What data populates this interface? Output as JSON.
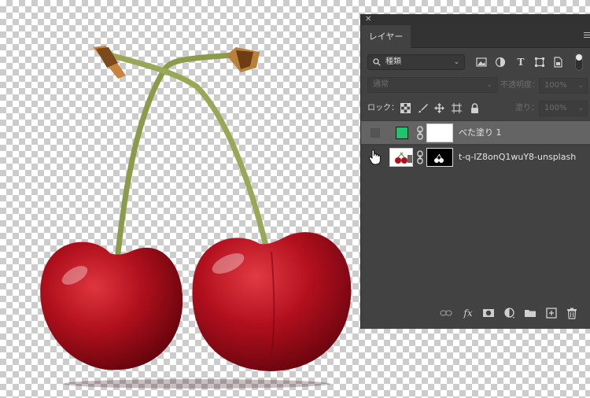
{
  "panel": {
    "close_glyph": "✕",
    "tab_label": "レイヤー",
    "menu_icon": "menu-lines-icon"
  },
  "filter": {
    "kind_label": "種類",
    "icons": [
      "image-filter-icon",
      "adjustment-filter-icon",
      "type-filter-icon",
      "shape-filter-icon",
      "smartobject-filter-icon"
    ],
    "toggle": "filter-toggle"
  },
  "blend": {
    "mode": "通常",
    "opacity_label": "不透明度：",
    "opacity_value": "100%"
  },
  "lock": {
    "label": "ロック：",
    "fill_label": "塗り：",
    "fill_value": "100%",
    "icons": [
      "lock-transparent-icon",
      "lock-image-icon",
      "lock-position-icon",
      "lock-artboard-icon",
      "lock-all-icon"
    ]
  },
  "layers": [
    {
      "name": "べた塗り 1",
      "visible": false,
      "selected": true,
      "fill_color": "#22c36a"
    },
    {
      "name": "t-q-IZ8onQ1wuY8-unsplash",
      "visible": true,
      "selected": false
    }
  ],
  "bottom_icons": [
    "link-layers-icon",
    "fx-icon",
    "add-mask-icon",
    "new-adjustment-icon",
    "new-group-icon",
    "new-layer-icon",
    "delete-layer-icon"
  ],
  "fx_label": "fx",
  "colors": {
    "panel_bg": "#424242",
    "selected_row": "#646464",
    "cherry": "#b0101c",
    "stem": "#8a9b4a"
  }
}
